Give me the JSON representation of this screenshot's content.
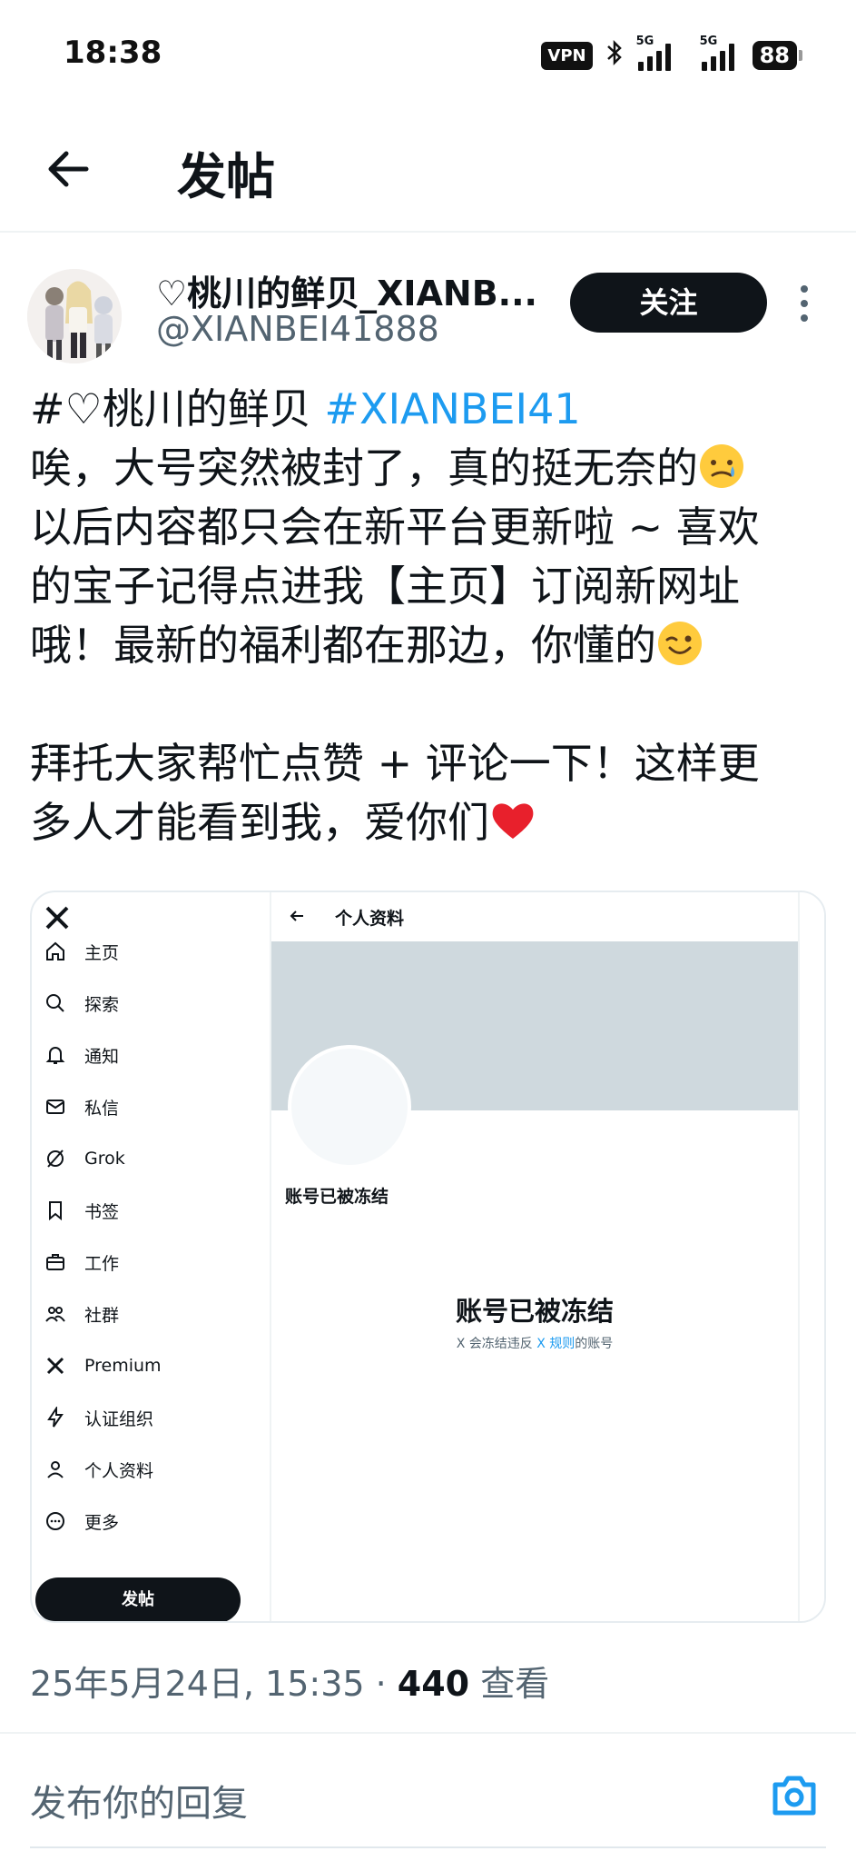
{
  "status_bar": {
    "time": "18:38",
    "vpn": "VPN",
    "signal1": "5G",
    "signal2": "5G",
    "battery": "88"
  },
  "header": {
    "title": "发帖"
  },
  "author": {
    "name": "♡桃川的鲜贝_XIANB...",
    "handle": "@XIANBEI41888",
    "follow_label": "关注"
  },
  "tweet": {
    "line1_text": "#♡桃川的鲜贝 ",
    "line1_hashtag": "#XIANBEI41",
    "line2": "唉，大号突然被封了，真的挺无奈的",
    "line2_emoji": "crying-smile-emoji",
    "line3": "以后内容都只会在新平台更新啦 ~ 喜欢",
    "line4": "的宝子记得点进我【主页】订阅新网址",
    "line5": "哦！最新的福利都在那边，你懂的",
    "line5_emoji": "wink-emoji",
    "line6": "拜托大家帮忙点赞 + 评论一下！这样更",
    "line7": "多人才能看到我，爱你们",
    "line7_emoji": "red-heart-emoji"
  },
  "embedded": {
    "nav": [
      {
        "label": "主页",
        "icon": "home-icon"
      },
      {
        "label": "探索",
        "icon": "search-icon"
      },
      {
        "label": "通知",
        "icon": "bell-icon"
      },
      {
        "label": "私信",
        "icon": "mail-icon"
      },
      {
        "label": "Grok",
        "icon": "grok-icon"
      },
      {
        "label": "书签",
        "icon": "bookmark-icon"
      },
      {
        "label": "工作",
        "icon": "briefcase-icon"
      },
      {
        "label": "社群",
        "icon": "community-icon"
      },
      {
        "label": "Premium",
        "icon": "x-logo-icon"
      },
      {
        "label": "认证组织",
        "icon": "lightning-icon"
      },
      {
        "label": "个人资料",
        "icon": "person-icon"
      },
      {
        "label": "更多",
        "icon": "more-circle-icon"
      }
    ],
    "post_button": "发帖",
    "page_title": "个人资料",
    "frozen_small": "账号已被冻结",
    "frozen_big": "账号已被冻结",
    "frozen_desc_pre": "X 会冻结违反 ",
    "frozen_desc_link": "X 规则",
    "frozen_desc_post": "的账号"
  },
  "meta": {
    "date": "25年5月24日, 15:35 · ",
    "views_count": "440",
    "views_label": " 查看"
  },
  "reply": {
    "placeholder": "发布你的回复"
  }
}
